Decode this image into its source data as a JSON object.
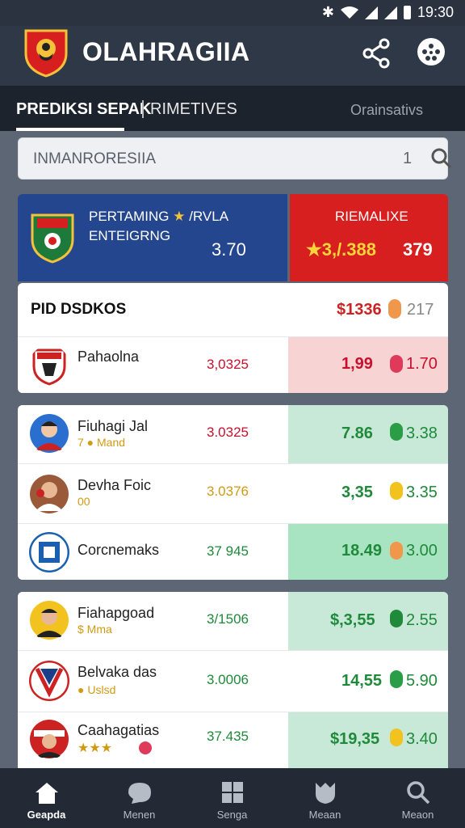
{
  "status": {
    "time": "19:30"
  },
  "app": {
    "title": "OLAHRAGIIA"
  },
  "tabs": [
    {
      "label": "PREDIKSI SEPAK"
    },
    {
      "label": "RIMETIVES"
    },
    {
      "label": "Orainsativs"
    }
  ],
  "search": {
    "value": "INMANRORESIIA",
    "count": "1"
  },
  "featured": {
    "line1": "PERTAMING",
    "star": "★",
    "line1_tail": "/RVLA",
    "line2": "ENTEIGRNG",
    "odd": "3.70",
    "right_label": "RIEMALIXE",
    "right_value": "★3,/.388",
    "right_value2": "379"
  },
  "header_row": {
    "title": "PID DSDKOS",
    "value1": "$1336",
    "value2": "217"
  },
  "rows": [
    {
      "name": "Pahaolna",
      "sub": "",
      "mid": "3,0325",
      "odd1": "1,99",
      "odd2": "1.70"
    },
    {
      "name": "Fiuhagi Jal",
      "sub": "7 ● Mand",
      "mid": "3.0325",
      "odd1": "7.86",
      "odd2": "3.38"
    },
    {
      "name": "Devha Foic",
      "sub": "00",
      "mid": "3.0376",
      "odd1": "3,35",
      "odd2": "3.35"
    },
    {
      "name": "Corcnemaks",
      "sub": "",
      "mid": "37 945",
      "odd1": "18.49",
      "odd2": "3.00"
    },
    {
      "name": "Fiahapgoad",
      "sub": "$ Mma",
      "mid": "3/1506",
      "odd1": "$,3,55",
      "odd2": "2.55"
    },
    {
      "name": "Belvaka das",
      "sub": "● Uslsd",
      "mid": "3.0006",
      "odd1": "14,55",
      "odd2": "5.90"
    },
    {
      "name": "Caahagatias",
      "sub": "★★★",
      "mid": "37.435",
      "odd1": "$19,35",
      "odd2": "3.40"
    }
  ],
  "nav": [
    {
      "label": "Geapda"
    },
    {
      "label": "Menen"
    },
    {
      "label": "Senga"
    },
    {
      "label": "Meaan"
    },
    {
      "label": "Meaon"
    }
  ],
  "colors": {
    "accent_blue": "#24468f",
    "accent_red": "#d71f1f",
    "odd_green": "#1f8a3a",
    "odd_red": "#c8102e"
  }
}
